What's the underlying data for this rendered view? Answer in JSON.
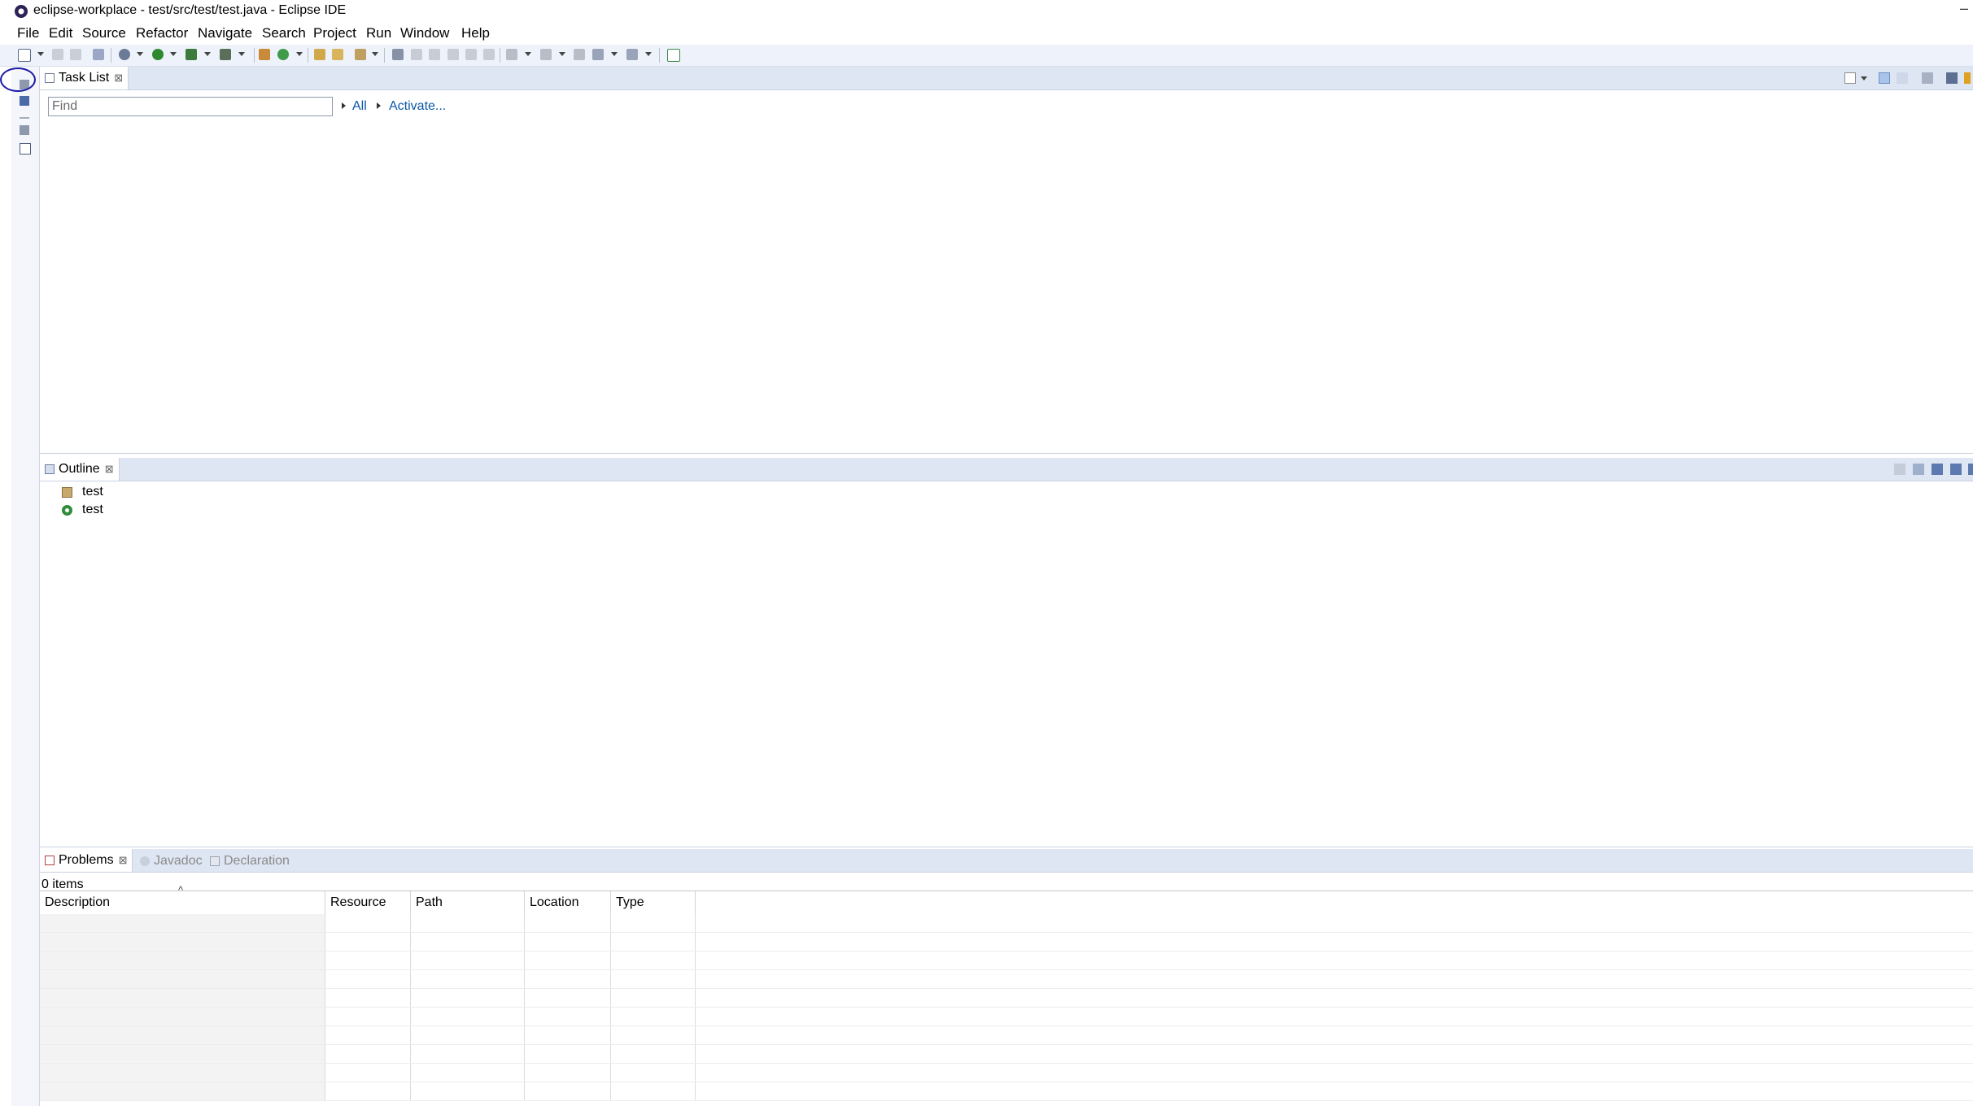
{
  "window": {
    "title": "eclipse-workplace - test/src/test/test.java - Eclipse IDE",
    "minimize_glyph": "–"
  },
  "menubar": {
    "items": [
      "File",
      "Edit",
      "Source",
      "Refactor",
      "Navigate",
      "Search",
      "Project",
      "Run",
      "Window",
      "Help"
    ]
  },
  "task_list": {
    "tab_label": "Task List",
    "close_glyph": "⊠",
    "find_placeholder": "Find",
    "find_value": "",
    "all_link": "All",
    "activate_link": "Activate..."
  },
  "outline": {
    "tab_label": "Outline",
    "close_glyph": "⊠",
    "items": [
      {
        "label": "test",
        "icon": "package-declaration-icon"
      },
      {
        "label": "test",
        "icon": "public-class-icon"
      }
    ]
  },
  "bottom_panel": {
    "tabs": [
      {
        "label": "Problems",
        "active": true,
        "close_glyph": "⊠",
        "icon": "problems-icon"
      },
      {
        "label": "Javadoc",
        "active": false,
        "icon": "javadoc-icon"
      },
      {
        "label": "Declaration",
        "active": false,
        "icon": "declaration-icon"
      }
    ],
    "items_count": "0 items",
    "sort_indicator": "^",
    "columns": [
      "Description",
      "Resource",
      "Path",
      "Location",
      "Type"
    ]
  },
  "colors": {
    "accent_link": "#0a56a6",
    "header_bg": "#dfe6f3",
    "toolbar_bg": "#eef2fa",
    "highlight_circle": "#1a1aa6"
  }
}
